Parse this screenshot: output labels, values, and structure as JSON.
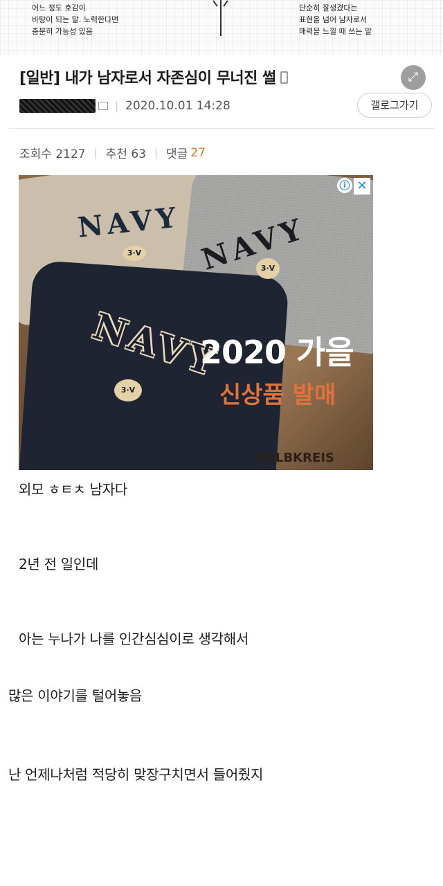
{
  "top_strip": {
    "left_lines": [
      "어느 정도 호감이",
      "바탕이 되는 말. 노력한다면",
      "충분히 가능성 있음"
    ],
    "right_lines": [
      "단순히 잘생겼다는",
      "표현을 넘어 남자로서",
      "매력을 느낄 때 쓰는 말"
    ]
  },
  "post": {
    "title": "[일반] 내가 남자로서 자존심이 무너진 썰",
    "date": "2020.10.01 14:28",
    "gallery_button": "갤로그가기",
    "stats": {
      "views_label": "조회수 2127",
      "recommend_label": "추천 63",
      "comments_label": "댓글",
      "comments_count": "27"
    }
  },
  "ad": {
    "shirt_text_1": "NAVY",
    "shirt_text_2": "NAVY",
    "shirt_text_3": "NAVY",
    "badge_1": "3·V",
    "badge_2": "3·V",
    "badge_3": "3·V",
    "headline": "2020 가을",
    "subline": "신상품 발매",
    "brand": "HALBKREIS",
    "info_icon": "info-icon",
    "close_icon": "close-icon"
  },
  "body": {
    "p1": "외모 ㅎㅌㅊ 남자다",
    "p2": "2년 전 일인데",
    "p3": "아는 누나가 나를 인간심심이로 생각해서",
    "p4": "많은 이야기를 털어놓음",
    "p5": "난 언제나처럼 적당히 맞장구치면서 들어줬지"
  },
  "colors": {
    "accent": "#d97a29",
    "ad_sub": "#e0733a",
    "ad_x": "#1a8fd6"
  }
}
